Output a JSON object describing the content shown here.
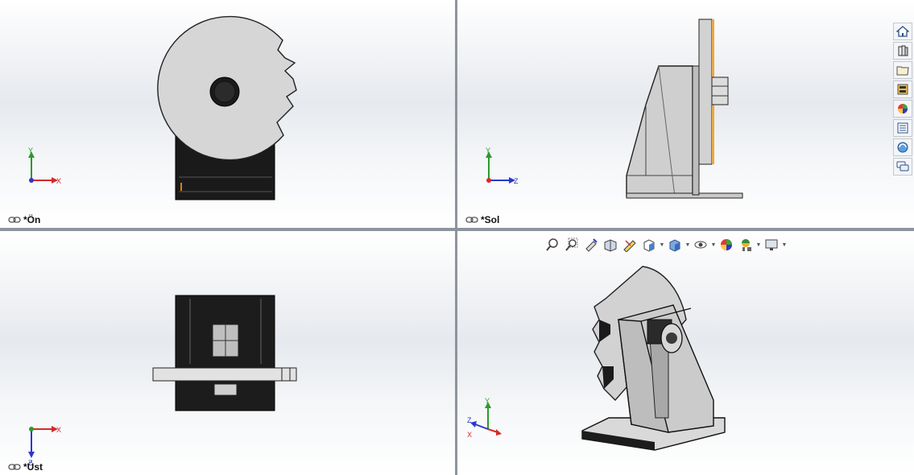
{
  "viewports": {
    "front": {
      "label": "*Ön",
      "triad": {
        "horizontal": "X",
        "vertical": "Y"
      }
    },
    "left": {
      "label": "*Sol",
      "triad": {
        "horizontal": "Z",
        "vertical": "Y"
      }
    },
    "top": {
      "label": "*Üst",
      "triad": {
        "horizontal": "X",
        "vertical": "Z"
      }
    },
    "iso": {
      "triad": {
        "x": "X",
        "y": "Y",
        "z": "Z"
      }
    }
  },
  "heads_up_toolbar": [
    "zoom-to-fit-icon",
    "zoom-to-area-icon",
    "previous-view-icon",
    "section-view-icon",
    "dynamic-annotation-icon",
    "view-orientation-icon",
    "display-style-icon",
    "hide-show-items-icon",
    "edit-appearance-icon",
    "apply-scene-icon",
    "view-settings-icon"
  ],
  "task_pane": [
    "home-icon",
    "design-library-icon",
    "file-explorer-icon",
    "view-palette-icon",
    "appearances-icon",
    "custom-properties-icon",
    "solidworks-forum-icon",
    "chat-icon"
  ],
  "colors": {
    "axis_x": "#d42a2a",
    "axis_y": "#2c9a2c",
    "axis_z": "#2a39c8",
    "part_light": "#d8d8d8",
    "part_dark": "#1a1a1a"
  }
}
